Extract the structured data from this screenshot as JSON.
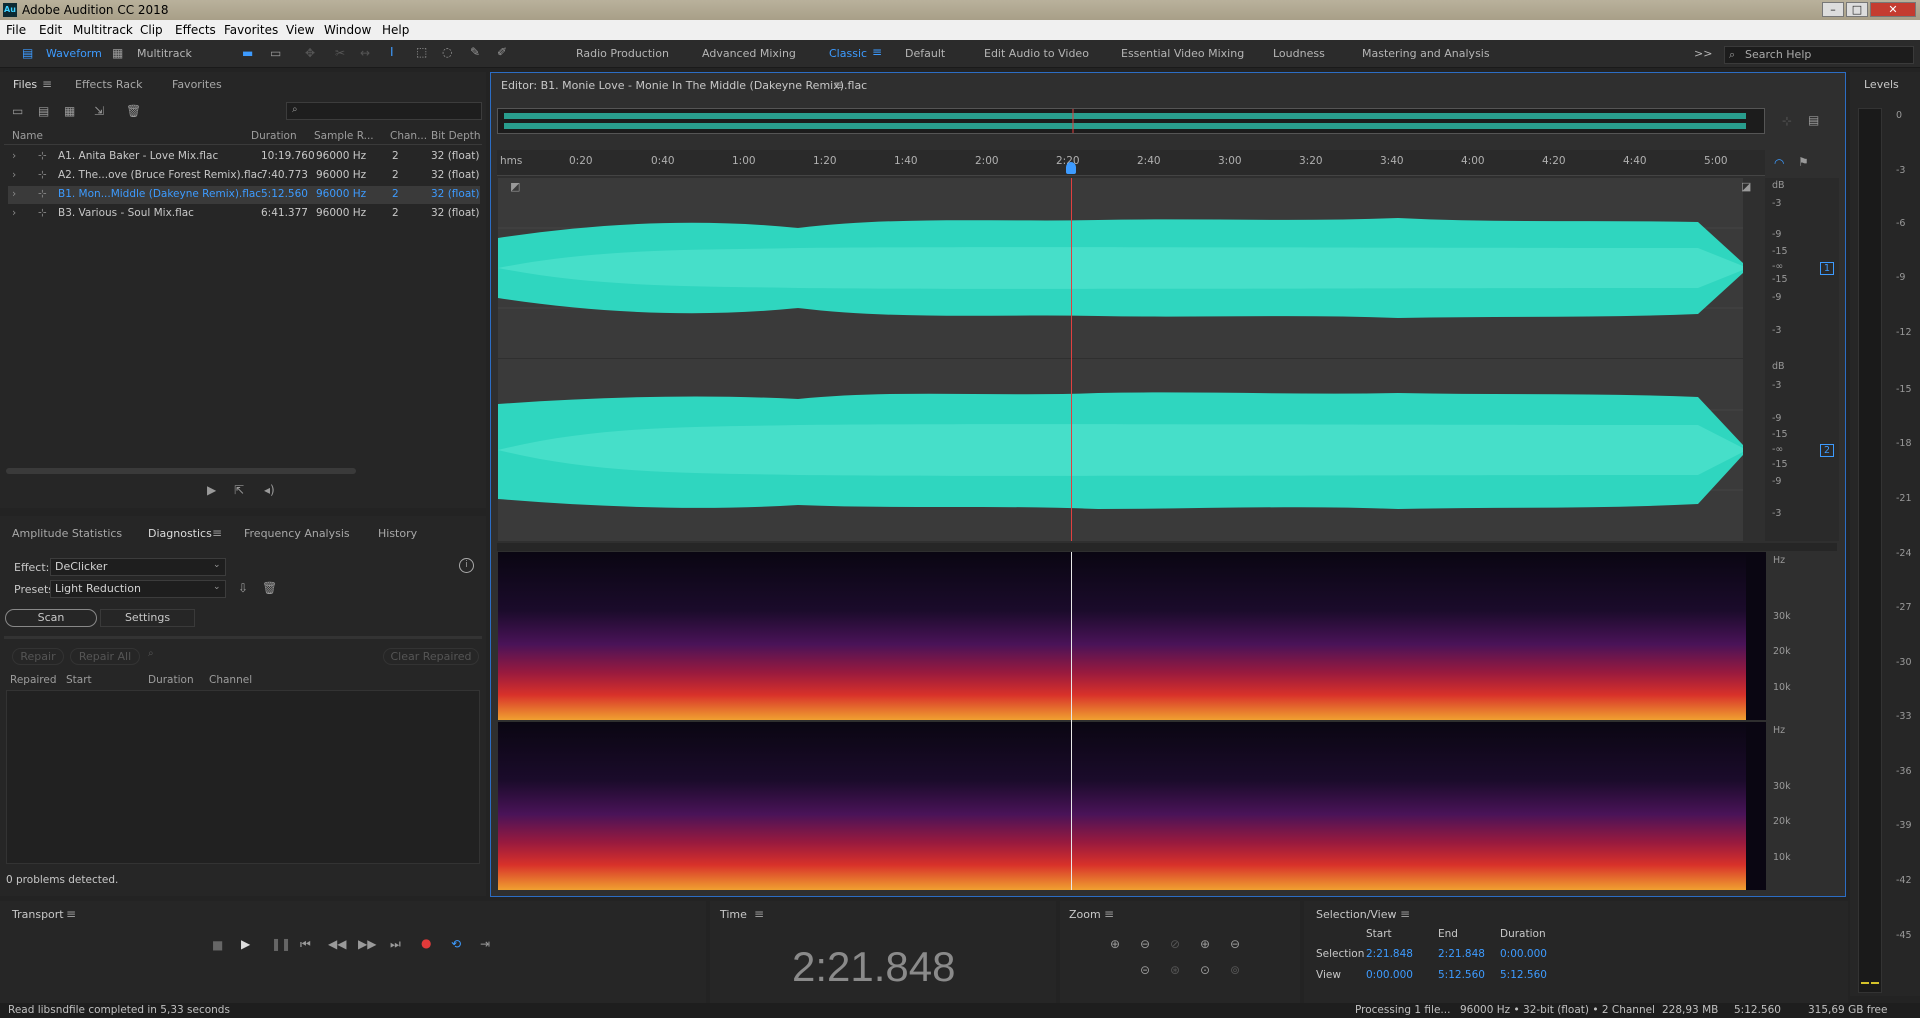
{
  "window": {
    "title": "Adobe Audition CC 2018",
    "logo": "Au",
    "controls": [
      "minimize-icon",
      "maximize-icon",
      "close-icon"
    ]
  },
  "menu": [
    "File",
    "Edit",
    "Multitrack",
    "Clip",
    "Effects",
    "Favorites",
    "View",
    "Window",
    "Help"
  ],
  "toolbar": {
    "waveform_label": "Waveform",
    "multitrack_label": "Multitrack",
    "workspaces": [
      "Radio Production",
      "Advanced Mixing",
      "Classic",
      "Default",
      "Edit Audio to Video",
      "Essential Video Mixing",
      "Loudness",
      "Mastering and Analysis"
    ],
    "active_workspace": "Classic",
    "search_placeholder": "Search Help",
    "more_label": ">>"
  },
  "files_panel": {
    "tabs": [
      "Files",
      "Effects Rack",
      "Favorites"
    ],
    "columns": [
      "Name",
      "Duration",
      "Sample R...",
      "Chan...",
      "Bit Depth"
    ],
    "rows": [
      {
        "name": "A1. Anita Baker - Love Mix.flac",
        "duration": "10:19.760",
        "rate": "96000 Hz",
        "ch": "2",
        "bits": "32 (float)"
      },
      {
        "name": "A2. The...ove (Bruce Forest Remix).flac",
        "duration": "7:40.773",
        "rate": "96000 Hz",
        "ch": "2",
        "bits": "32 (float)"
      },
      {
        "name": "B1. Mon...Middle (Dakeyne Remix).flac",
        "duration": "5:12.560",
        "rate": "96000 Hz",
        "ch": "2",
        "bits": "32 (float)"
      },
      {
        "name": "B3. Various - Soul Mix.flac",
        "duration": "6:41.377",
        "rate": "96000 Hz",
        "ch": "2",
        "bits": "32 (float)"
      }
    ],
    "selected_index": 2
  },
  "diag_panel": {
    "tabs": [
      "Amplitude Statistics",
      "Diagnostics",
      "Frequency Analysis",
      "History"
    ],
    "effect_label": "Effect:",
    "effect_value": "DeClicker",
    "presets_label": "Presets:",
    "presets_value": "Light Reduction",
    "scan_label": "Scan",
    "settings_label": "Settings",
    "repair_label": "Repair",
    "repair_all_label": "Repair All",
    "clear_label": "Clear Repaired",
    "columns": [
      "Repaired",
      "Start",
      "Duration",
      "Channel"
    ],
    "status": "0 problems detected."
  },
  "editor": {
    "title": "Editor: B1. Monie Love - Monie In The Middle (Dakeyne Remix).flac",
    "ruler_unit": "hms",
    "ruler": [
      "0:20",
      "0:40",
      "1:00",
      "1:20",
      "1:40",
      "2:00",
      "2:20",
      "2:40",
      "3:00",
      "3:20",
      "3:40",
      "4:00",
      "4:20",
      "4:40",
      "5:00"
    ],
    "db_scale": [
      "dB",
      "-3",
      "-9",
      "-15",
      "-∞",
      "-15",
      "-9",
      "-3"
    ],
    "channels": [
      "1",
      "2"
    ],
    "spec_hz": [
      "Hz",
      "30k",
      "20k",
      "10k"
    ]
  },
  "levels": {
    "title": "Levels",
    "scale": [
      "0",
      "-3",
      "-6",
      "-9",
      "-12",
      "-15",
      "-18",
      "-21",
      "-24",
      "-27",
      "-30",
      "-33",
      "-36",
      "-39",
      "-42",
      "-45"
    ]
  },
  "transport": {
    "title": "Transport"
  },
  "time": {
    "title": "Time",
    "value": "2:21.848"
  },
  "zoom": {
    "title": "Zoom"
  },
  "selection": {
    "title": "Selection/View",
    "headers": [
      "Start",
      "End",
      "Duration"
    ],
    "rows": [
      {
        "label": "Selection",
        "start": "2:21.848",
        "end": "2:21.848",
        "duration": "0:00.000"
      },
      {
        "label": "View",
        "start": "0:00.000",
        "end": "5:12.560",
        "duration": "5:12.560"
      }
    ]
  },
  "status": {
    "left": "Read libsndfile completed in 5,33 seconds",
    "processing": "Processing 1 file...",
    "format": "96000 Hz • 32-bit (float) • 2 Channel",
    "size": "228,93 MB",
    "duration": "5:12.560",
    "free": "315,69 GB free"
  },
  "colors": {
    "accent": "#3d9bff",
    "waveform": "#2fd6bf",
    "playhead": "#e04040",
    "editor_border": "#2c6dc4"
  }
}
